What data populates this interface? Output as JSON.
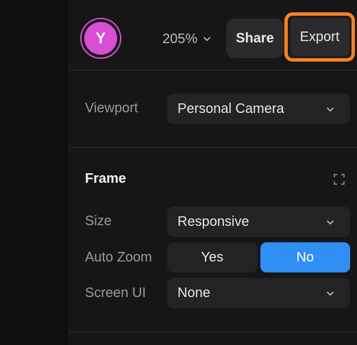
{
  "header": {
    "avatar_initial": "Y",
    "zoom_level": "205%",
    "share_label": "Share",
    "export_label": "Export"
  },
  "viewport": {
    "label": "Viewport",
    "value": "Personal Camera"
  },
  "frame": {
    "title": "Frame",
    "size_label": "Size",
    "size_value": "Responsive",
    "auto_zoom_label": "Auto Zoom",
    "auto_zoom_yes": "Yes",
    "auto_zoom_no": "No",
    "auto_zoom_selected": "No",
    "screen_ui_label": "Screen UI",
    "screen_ui_value": "None"
  },
  "colors": {
    "avatar": "#d84fd6",
    "highlight": "#f58220",
    "accent": "#2f8ff5"
  },
  "icons": {
    "zoom_dropdown": "chevron-down-icon",
    "select_dropdown": "chevron-down-icon",
    "frame_expand": "expand-icon"
  }
}
